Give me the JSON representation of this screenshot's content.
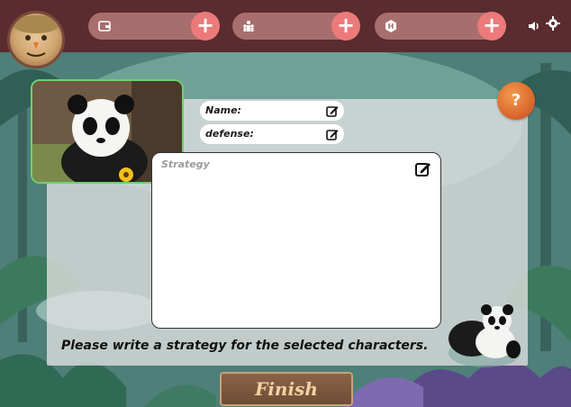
{
  "header": {
    "resources": [
      {
        "icon": "wallet-icon",
        "add_icon": "plus-icon"
      },
      {
        "icon": "team-icon",
        "add_icon": "plus-icon"
      },
      {
        "icon": "hex-coin-icon",
        "add_icon": "plus-icon"
      }
    ],
    "sound_icon": "speaker-icon",
    "settings_icon": "gear-icon"
  },
  "form": {
    "name_label": "Name:",
    "defense_label": "defense:",
    "strategy_placeholder": "Strategy",
    "instruction": "Please write a strategy for the selected characters."
  },
  "help_label": "?",
  "finish_label": "Finish",
  "colors": {
    "topbar": "#5a2b2f",
    "pill": "#a86e6e",
    "plus": "#ec7a7a",
    "help_orange": "#e07636",
    "card_border": "#6fd06f"
  }
}
